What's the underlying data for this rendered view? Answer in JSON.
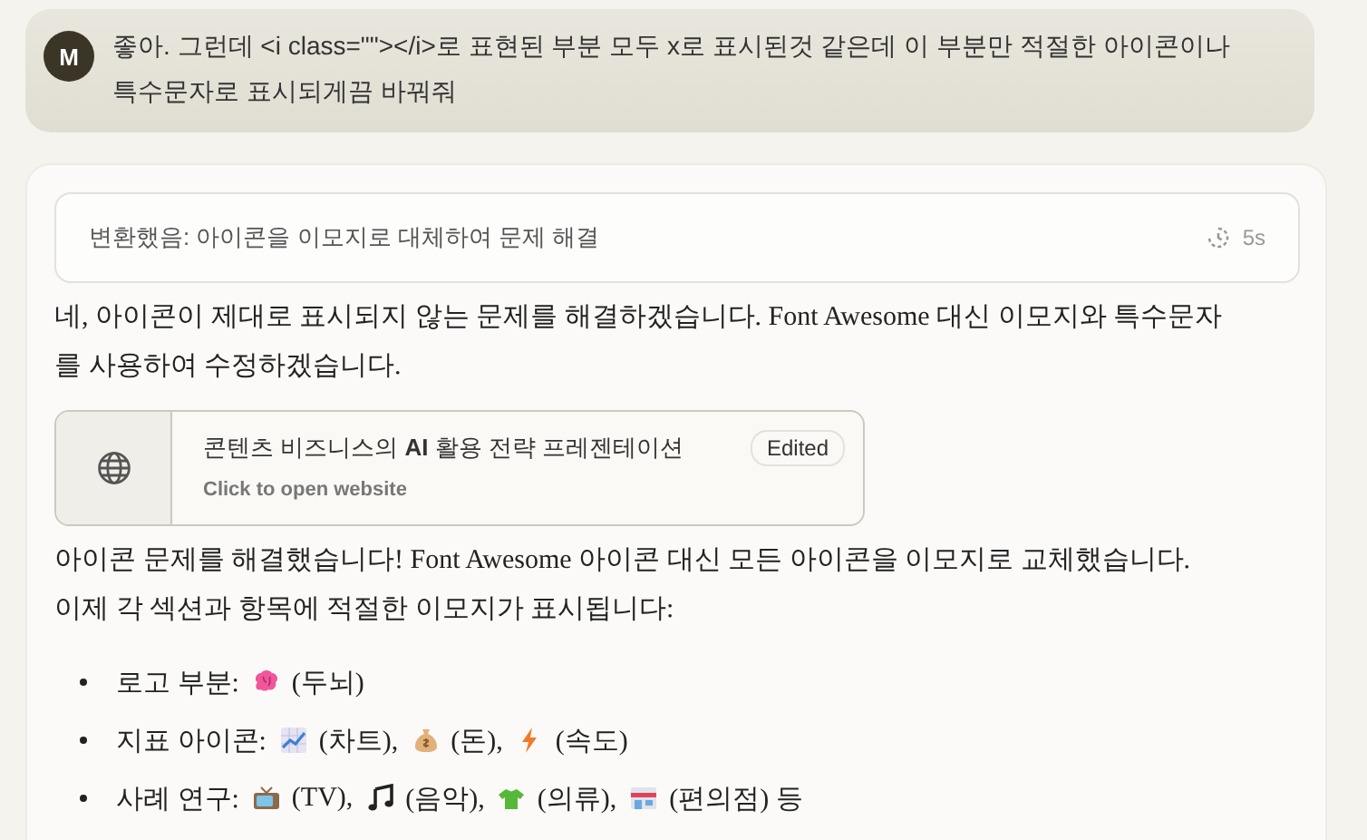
{
  "user_message": {
    "avatar": "M",
    "text": "좋아. 그런데 <i class=\"\"></i>로 표현된 부분 모두 x로 표시된것 같은데 이 부분만 적절한 아이콘이나 특수문자로 표시되게끔 바꿔줘"
  },
  "thinking": {
    "text": "변환했음: 아이콘을 이모지로 대체하여 문제 해결",
    "duration": "5s"
  },
  "reply_intro": "네, 아이콘이 제대로 표시되지 않는 문제를 해결하겠습니다. Font Awesome 대신 이모지와 특수문자를 사용하여 수정하겠습니다.",
  "artifact": {
    "title": "콘텐츠 비즈니스의 **AI** 활용 전략 프레젠테이션",
    "badge": "Edited",
    "subtitle": "Click to open website"
  },
  "reply_body": "아이콘 문제를 해결했습니다! Font Awesome 아이콘 대신 모든 아이콘을 이모지로 교체했습니다. 이제 각 섹션과 항목에 적절한 이모지가 표시됩니다:",
  "list": [
    {
      "label": "로고 부분:",
      "entries": [
        {
          "kind": "brain",
          "text": "(두뇌)"
        }
      ]
    },
    {
      "label": "지표 아이콘:",
      "entries": [
        {
          "kind": "chart",
          "text": "(차트),"
        },
        {
          "kind": "moneybag",
          "text": "(돈),"
        },
        {
          "kind": "bolt",
          "text": "(속도)"
        }
      ]
    },
    {
      "label": "사례 연구:",
      "entries": [
        {
          "kind": "tv",
          "text": "(TV),"
        },
        {
          "kind": "note",
          "text": "(음악),"
        },
        {
          "kind": "shirt",
          "text": "(의류),"
        },
        {
          "kind": "store",
          "text": "(편의점)"
        }
      ],
      "tail": "등"
    }
  ]
}
